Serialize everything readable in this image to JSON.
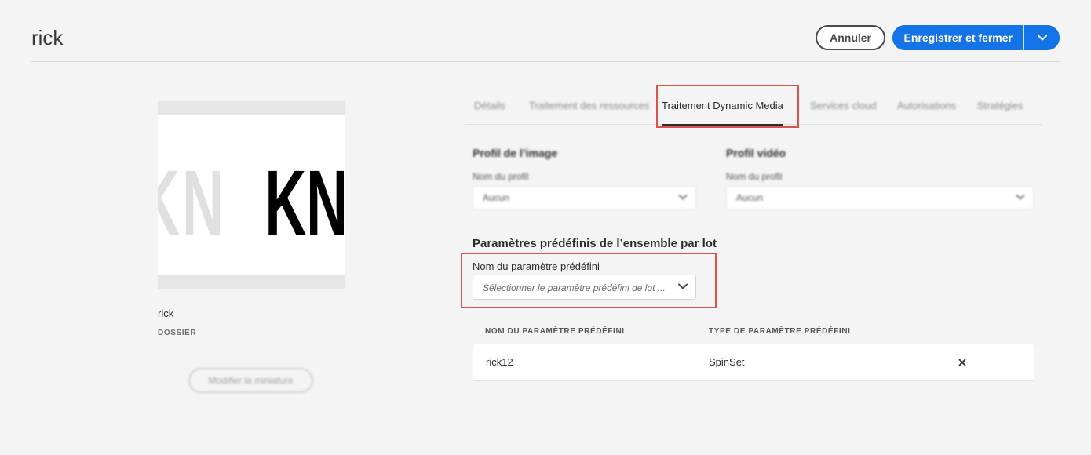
{
  "header": {
    "title": "rick",
    "cancel_label": "Annuler",
    "save_label": "Enregistrer et fermer"
  },
  "left_panel": {
    "thumbnail_text": [
      "K",
      "N",
      "K",
      "N"
    ],
    "folder_name": "rick",
    "folder_type": "DOSSIER",
    "edit_thumbnail_label": "Modifier la miniature"
  },
  "tabs": [
    {
      "label": "Détails"
    },
    {
      "label": "Traitement des ressources"
    },
    {
      "label": "Traitement Dynamic Media",
      "active": true
    },
    {
      "label": "Services cloud"
    },
    {
      "label": "Autorisations"
    },
    {
      "label": "Stratégies"
    }
  ],
  "image_profile": {
    "heading": "Profil de l’image",
    "field_label": "Nom du profil",
    "value": "Aucun"
  },
  "video_profile": {
    "heading": "Profil vidéo",
    "field_label": "Nom du profil",
    "value": "Aucun"
  },
  "batch_set": {
    "heading": "Paramètres prédéfinis de l’ensemble par lot",
    "field_label": "Nom du paramètre prédéfini",
    "placeholder": "Sélectionner le paramètre prédéfini de lot ...",
    "columns": [
      "NOM DU PARAMÈTRE PRÉDÉFINI",
      "TYPE DE PARAMÈTRE PRÉDÉFINI"
    ],
    "rows": [
      {
        "name": "rick12",
        "type": "SpinSet"
      }
    ]
  },
  "colors": {
    "accent": "#1473e6",
    "highlight_box": "#d9534f",
    "background": "#f4f4f4"
  }
}
